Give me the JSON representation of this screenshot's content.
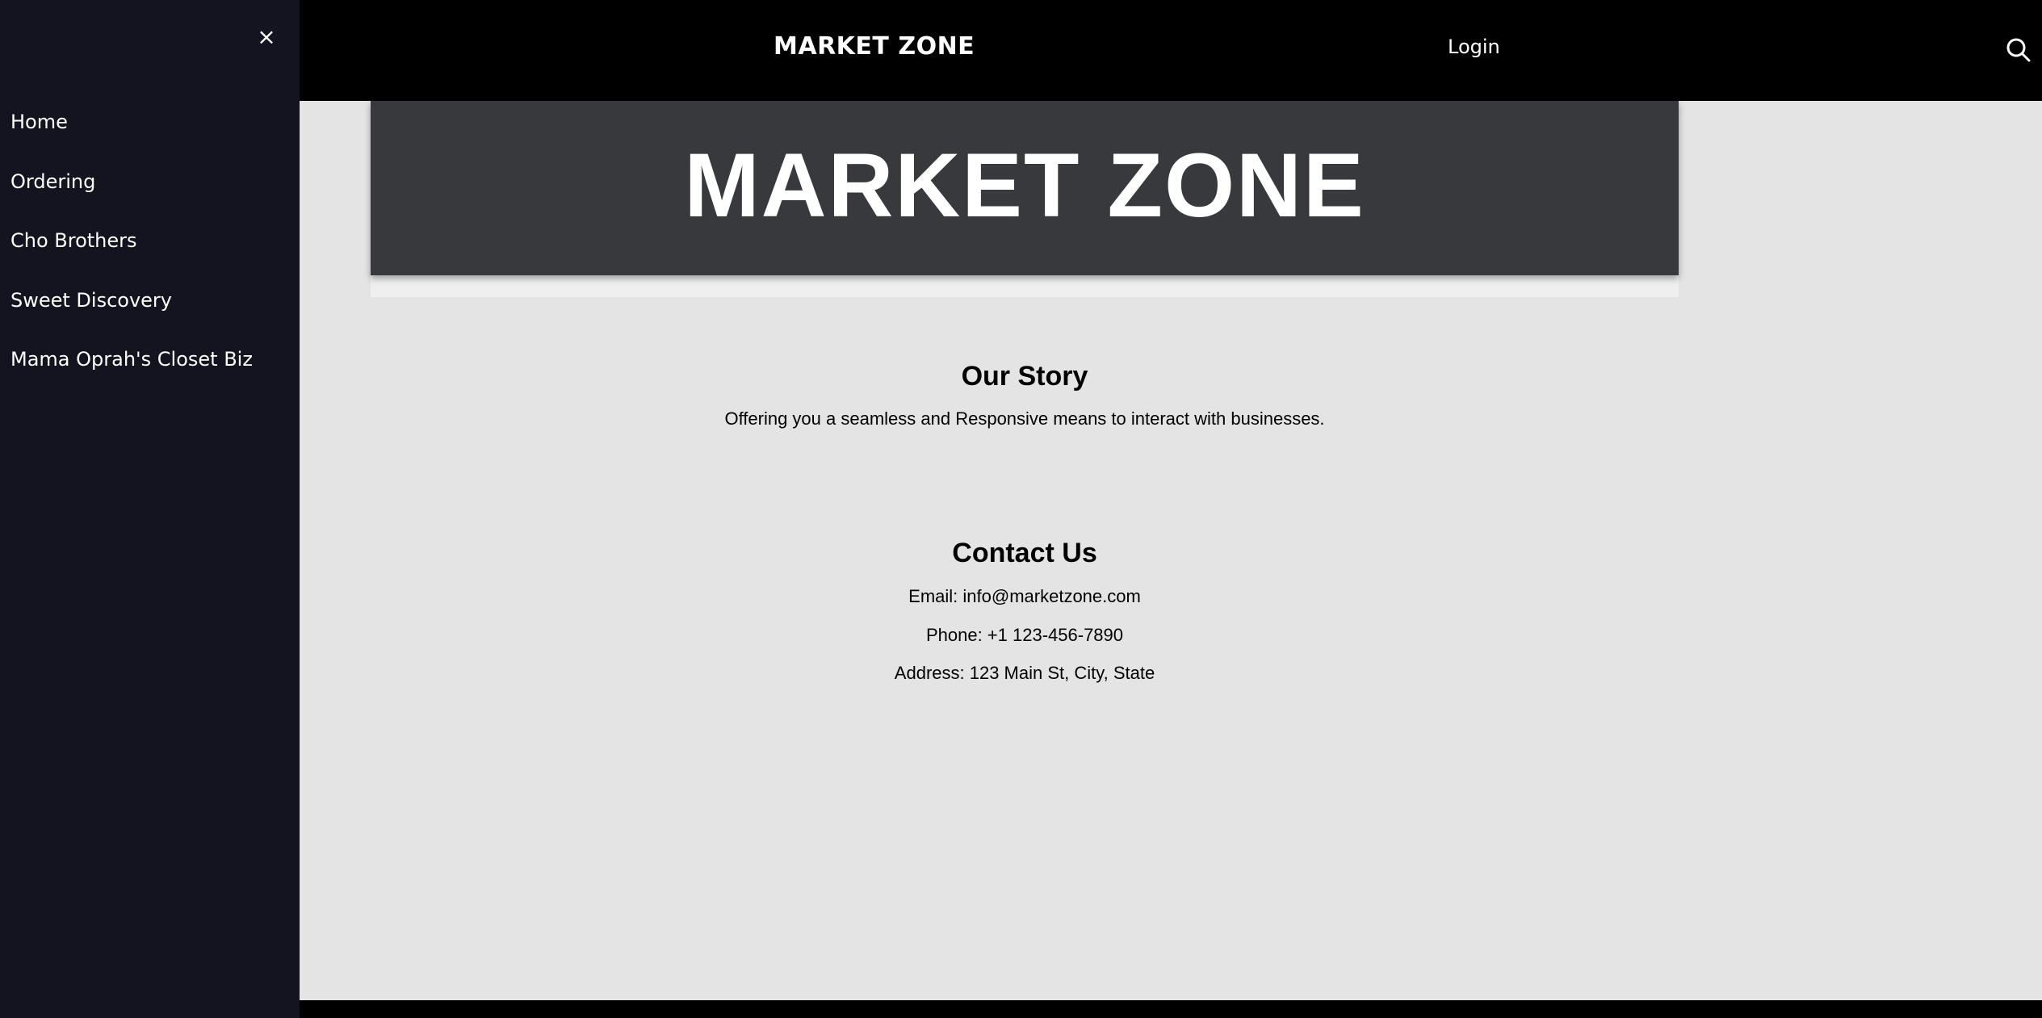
{
  "sidebar": {
    "close_icon": "×",
    "items": [
      {
        "label": "Home"
      },
      {
        "label": "Ordering"
      },
      {
        "label": "Cho Brothers"
      },
      {
        "label": "Sweet Discovery"
      },
      {
        "label": "Mama Oprah's Closet Biz"
      }
    ]
  },
  "header": {
    "brand": "MARKET ZONE",
    "login": "Login",
    "search_icon": "search-icon"
  },
  "hero": {
    "title": "MARKET ZONE"
  },
  "story": {
    "heading": "Our Story",
    "text": "Offering you a seamless and Responsive means to interact with businesses."
  },
  "contact": {
    "heading": "Contact Us",
    "email": "Email: info@marketzone.com",
    "phone": "Phone: +1 123-456-7890",
    "address": "Address: 123 Main St, City, State"
  },
  "colors": {
    "sidebar_bg": "#131420",
    "topbar_bg": "#000000",
    "hero_bg": "#38393c",
    "page_bg": "#e4e4e4"
  }
}
